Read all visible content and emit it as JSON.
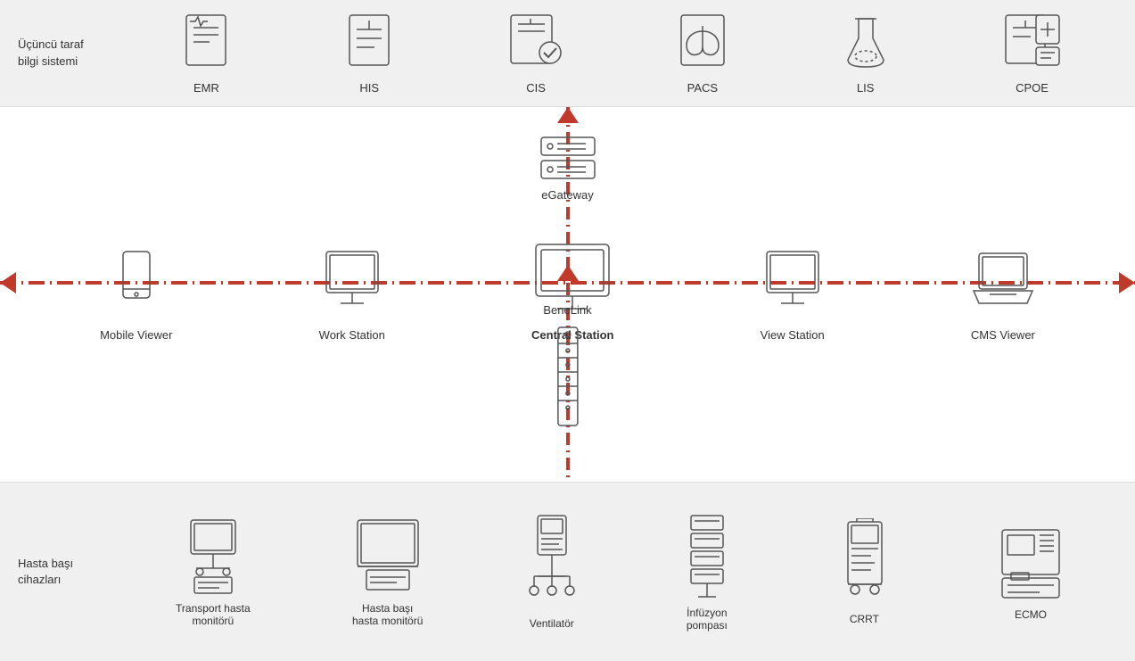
{
  "top": {
    "label": "Üçüncü taraf\nbilgi sistemi",
    "items": [
      {
        "id": "emr",
        "label": "EMR"
      },
      {
        "id": "his",
        "label": "HIS"
      },
      {
        "id": "cis",
        "label": "CIS"
      },
      {
        "id": "pacs",
        "label": "PACS"
      },
      {
        "id": "lis",
        "label": "LIS"
      },
      {
        "id": "cpoe",
        "label": "CPOE"
      }
    ]
  },
  "middle": {
    "egateway_label": "eGateway",
    "benelink_label": "BeneLink",
    "devices": [
      {
        "id": "mobile-viewer",
        "label": "Mobile Viewer"
      },
      {
        "id": "work-station",
        "label": "Work Station"
      },
      {
        "id": "central-station",
        "label": "Central Station"
      },
      {
        "id": "view-station",
        "label": "View Station"
      },
      {
        "id": "cms-viewer",
        "label": "CMS Viewer"
      }
    ]
  },
  "bottom": {
    "label": "Hasta başı\ncihazları",
    "items": [
      {
        "id": "transport",
        "label": "Transport hasta\nmonitörü"
      },
      {
        "id": "bedside",
        "label": "Hasta başı\nhasta monitörü"
      },
      {
        "id": "ventilator",
        "label": "Ventilatör"
      },
      {
        "id": "infusion",
        "label": "İnfüzyon\npompası"
      },
      {
        "id": "crrt",
        "label": "CRRT"
      },
      {
        "id": "ecmo",
        "label": "ECMO"
      }
    ]
  },
  "colors": {
    "red": "#c0392b",
    "gray": "#555",
    "light_bg": "#f0f0f0",
    "white": "#ffffff"
  }
}
